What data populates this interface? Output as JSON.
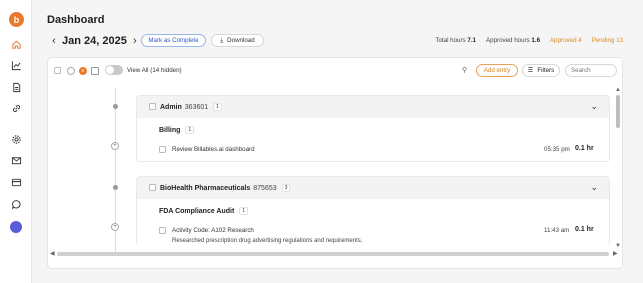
{
  "sidebar": {
    "logo_text": "b",
    "items": [
      {
        "icon": "home-icon",
        "active": true
      },
      {
        "icon": "chart-line-icon"
      },
      {
        "icon": "document-icon"
      },
      {
        "icon": "link-icon"
      },
      {
        "icon": "gear-icon"
      },
      {
        "icon": "mail-icon"
      },
      {
        "icon": "card-icon"
      },
      {
        "icon": "chat-icon"
      },
      {
        "icon": "avatar-icon"
      }
    ]
  },
  "page": {
    "title": "Dashboard"
  },
  "datebar": {
    "prev": "‹",
    "date": "Jan 24, 2025",
    "next": "›",
    "mark_complete": "Mark as Complete",
    "download": "Download"
  },
  "stats": {
    "total_label": "Total hours",
    "total_value": "7.1",
    "approved_hours_label": "Approved hours",
    "approved_hours_value": "1.6",
    "approved": "Approved 4",
    "pending": "Pending 13"
  },
  "toolbar": {
    "view_all": "View All (14 hidden)",
    "add_entry": "Add entry",
    "filters": "Filters",
    "search_placeholder": "Search"
  },
  "groups": [
    {
      "name": "Admin",
      "code": "363601",
      "count": "1",
      "tasks": [
        {
          "name": "Billing",
          "count": "1",
          "entries": [
            {
              "text": "Review Billables.ai dashboard",
              "description": "",
              "time": "05:35 pm",
              "hours": "0.1 hr"
            }
          ]
        }
      ]
    },
    {
      "name": "BioHealth Pharmaceuticals",
      "code": "875653",
      "count": "3",
      "tasks": [
        {
          "name": "FDA Compliance Audit",
          "count": "1",
          "entries": [
            {
              "text": "Activity Code: A102 Research",
              "description": "Researched prescription drug advertising regulations and requirements.",
              "time": "11:43 am",
              "hours": "0.1 hr"
            }
          ]
        }
      ]
    }
  ],
  "colors": {
    "brand": "#e8792d",
    "approved": "#d98a1f",
    "pending": "#d98a1f",
    "link": "#2e5bbf"
  }
}
